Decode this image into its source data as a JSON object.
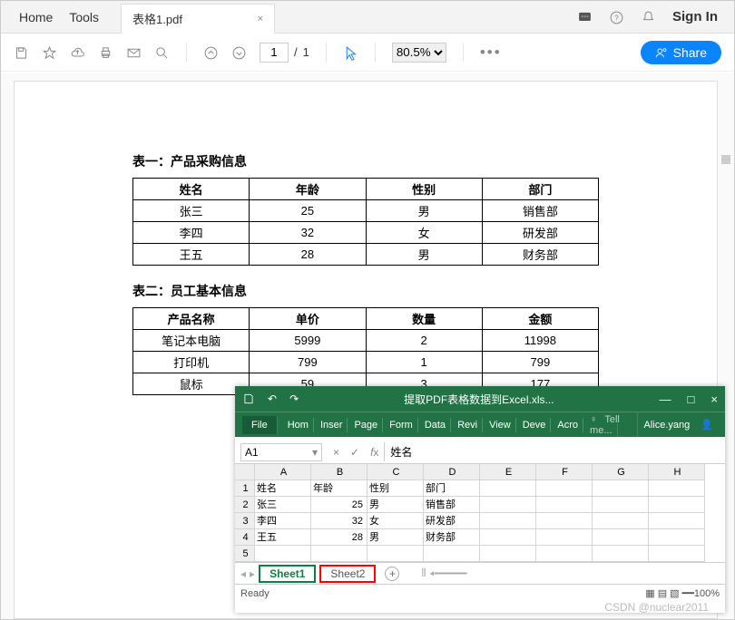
{
  "nav": {
    "home": "Home",
    "tools": "Tools"
  },
  "doc_tab": {
    "title": "表格1.pdf",
    "close": "×"
  },
  "top_right": {
    "signin": "Sign In"
  },
  "toolbar": {
    "page_current": "1",
    "page_total": "1",
    "zoom": "80.5%"
  },
  "share_label": "Share",
  "pdf": {
    "table1_title": "表一：产品采购信息",
    "t1_headers": [
      "姓名",
      "年龄",
      "性别",
      "部门"
    ],
    "t1_rows": [
      [
        "张三",
        "25",
        "男",
        "销售部"
      ],
      [
        "李四",
        "32",
        "女",
        "研发部"
      ],
      [
        "王五",
        "28",
        "男",
        "财务部"
      ]
    ],
    "table2_title": "表二：员工基本信息",
    "t2_headers": [
      "产品名称",
      "单价",
      "数量",
      "金额"
    ],
    "t2_rows": [
      [
        "笔记本电脑",
        "5999",
        "2",
        "11998"
      ],
      [
        "打印机",
        "799",
        "1",
        "799"
      ],
      [
        "鼠标",
        "59",
        "3",
        "177"
      ]
    ]
  },
  "excel": {
    "title": "提取PDF表格数据到Excel.xls...",
    "ribbon": {
      "file": "File",
      "home": "Hom",
      "insert": "Inser",
      "page": "Page",
      "form": "Form",
      "data": "Data",
      "review": "Revi",
      "view": "View",
      "dev": "Deve",
      "acro": "Acro",
      "tell": "Tell me...",
      "user": "Alice.yang"
    },
    "namebox": "A1",
    "fx_value": "姓名",
    "cols": [
      "A",
      "B",
      "C",
      "D",
      "E",
      "F",
      "G",
      "H"
    ],
    "rows": [
      {
        "n": "1",
        "c": [
          "姓名",
          "年龄",
          "性别",
          "部门",
          "",
          "",
          "",
          ""
        ]
      },
      {
        "n": "2",
        "c": [
          "张三",
          "25",
          "男",
          "销售部",
          "",
          "",
          "",
          ""
        ]
      },
      {
        "n": "3",
        "c": [
          "李四",
          "32",
          "女",
          "研发部",
          "",
          "",
          "",
          ""
        ]
      },
      {
        "n": "4",
        "c": [
          "王五",
          "28",
          "男",
          "财务部",
          "",
          "",
          "",
          ""
        ]
      },
      {
        "n": "5",
        "c": [
          "",
          "",
          "",
          "",
          "",
          "",
          "",
          ""
        ]
      }
    ],
    "numcols": [
      1
    ],
    "sheets": {
      "s1": "Sheet1",
      "s2": "Sheet2"
    },
    "status": "Ready",
    "zoom": "100%"
  },
  "watermark": "CSDN @nuclear2011"
}
